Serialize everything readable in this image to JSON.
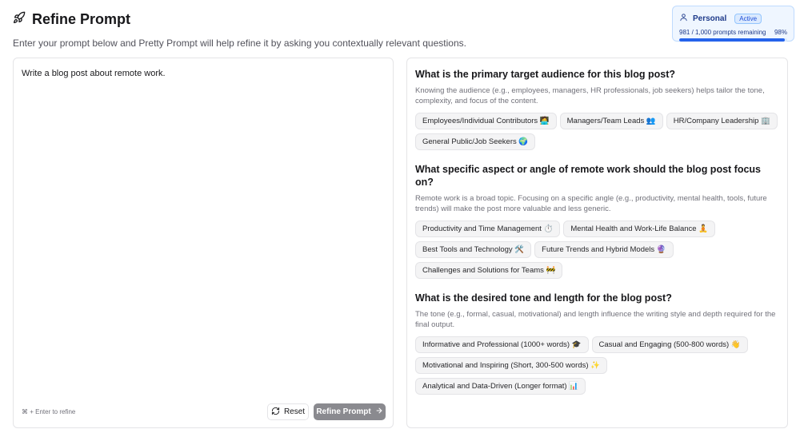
{
  "header": {
    "title": "Refine Prompt",
    "subtitle": "Enter your prompt below and Pretty Prompt will help refine it by asking you contextually relevant questions."
  },
  "account": {
    "plan": "Personal",
    "status": "Active",
    "usage_text": "981 / 1,000 prompts remaining",
    "usage_percent_text": "98%",
    "usage_fraction": 0.98,
    "accent_color": "#2563eb"
  },
  "editor": {
    "prompt": "Write a blog post about remote work.",
    "shortcut_hint": "⌘ + Enter to refine",
    "reset_label": "Reset",
    "refine_label": "Refine Prompt"
  },
  "questions": [
    {
      "title": "What is the primary target audience for this blog post?",
      "description": "Knowing the audience (e.g., employees, managers, HR professionals, job seekers) helps tailor the tone, complexity, and focus of the content.",
      "options": [
        "Employees/Individual Contributors 🧑‍💻",
        "Managers/Team Leads 👥",
        "HR/Company Leadership 🏢",
        "General Public/Job Seekers 🌍"
      ]
    },
    {
      "title": "What specific aspect or angle of remote work should the blog post focus on?",
      "description": "Remote work is a broad topic. Focusing on a specific angle (e.g., productivity, mental health, tools, future trends) will make the post more valuable and less generic.",
      "options": [
        "Productivity and Time Management ⏱️",
        "Mental Health and Work-Life Balance 🧘",
        "Best Tools and Technology 🛠️",
        "Future Trends and Hybrid Models 🔮",
        "Challenges and Solutions for Teams 🚧"
      ]
    },
    {
      "title": "What is the desired tone and length for the blog post?",
      "description": "The tone (e.g., formal, casual, motivational) and length influence the writing style and depth required for the final output.",
      "options": [
        "Informative and Professional (1000+ words) 🎓",
        "Casual and Engaging (500-800 words) 👋",
        "Motivational and Inspiring (Short, 300-500 words) ✨",
        "Analytical and Data-Driven (Longer format) 📊"
      ]
    }
  ]
}
